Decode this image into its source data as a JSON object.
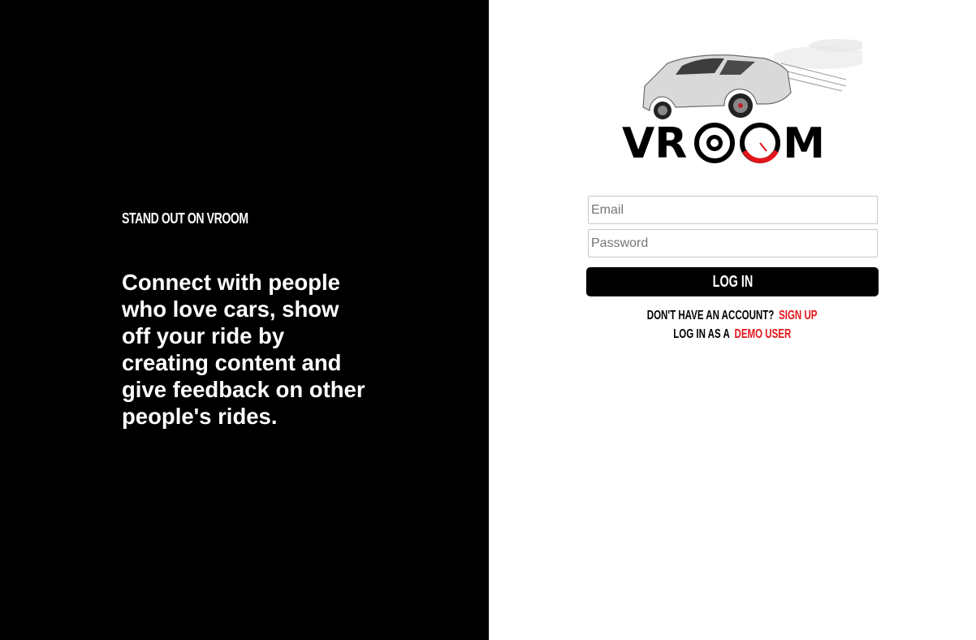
{
  "left": {
    "tagline": "STAND OUT ON VROOM",
    "description": "Connect with people who love cars, show off your ride by creating content and give feedback on other people's rides."
  },
  "brand": {
    "logo_text": "VROOM",
    "colors": {
      "black": "#000000",
      "accent_red": "#e3151a",
      "white": "#ffffff"
    }
  },
  "form": {
    "email_placeholder": "Email",
    "password_placeholder": "Password",
    "login_label": "LOG IN"
  },
  "links": {
    "no_account_text": "DON'T HAVE AN ACCOUNT?",
    "signup_label": "SIGN UP",
    "demo_prefix": "LOG IN AS A",
    "demo_label": "DEMO USER"
  }
}
